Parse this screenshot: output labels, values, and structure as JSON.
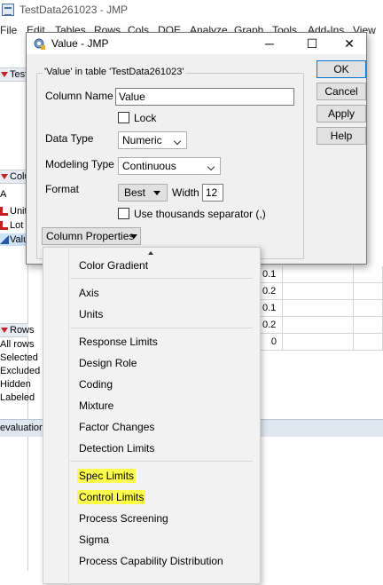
{
  "background_window": {
    "title": "TestData261023 - JMP",
    "menu": [
      "File",
      "Edit",
      "Tables",
      "Rows",
      "Cols",
      "DOE",
      "Analyze",
      "Graph",
      "Tools",
      "Add-Ins",
      "View"
    ],
    "table_panel_label": "Test",
    "columns_panel_label": "Colu",
    "columns_header_fragment": "A",
    "columns": [
      "Unit",
      "Lot",
      "Valu"
    ],
    "rows_panel_label": "Rows",
    "rows_items": [
      "All rows",
      "Selected",
      "Excluded",
      "Hidden",
      "Labeled"
    ],
    "cell_values": [
      "0.1",
      "0.2",
      "0.1",
      "0.2",
      "0"
    ],
    "status_text": "evaluation"
  },
  "dialog": {
    "title": "Value - JMP",
    "minimize_icon": "─",
    "maximize_icon": "☐",
    "close_icon": "✕",
    "group_label": "'Value' in table 'TestData261023'",
    "column_name_label": "Column Name",
    "column_name_value": "Value",
    "lock_label": "Lock",
    "data_type_label": "Data Type",
    "data_type_value": "Numeric",
    "modeling_type_label": "Modeling Type",
    "modeling_type_value": "Continuous",
    "format_label": "Format",
    "format_value": "Best",
    "width_label": "Width",
    "width_value": "12",
    "thousands_label": "Use thousands separator (,)",
    "column_properties_label": "Column Properties",
    "buttons": {
      "ok": "OK",
      "cancel": "Cancel",
      "apply": "Apply",
      "help": "Help"
    }
  },
  "menu": {
    "top_partial": "Color Gradient",
    "group1": [
      "Axis",
      "Units"
    ],
    "group2": [
      "Response Limits",
      "Design Role",
      "Coding",
      "Mixture",
      "Factor Changes",
      "Detection Limits"
    ],
    "group3": [
      "Spec Limits",
      "Control Limits",
      "Process Screening",
      "Sigma",
      "Process Capability Distribution"
    ],
    "highlight_color": "#ffff4d"
  }
}
